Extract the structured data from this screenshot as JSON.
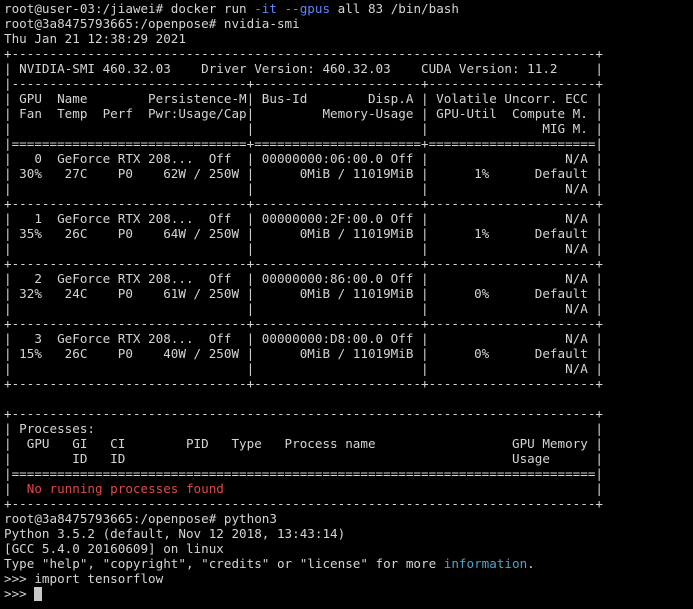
{
  "palette": {
    "background": "#000000",
    "text": "#d4d4d4",
    "option_flag": "#5f87ff",
    "error": "#e04848",
    "link": "#4fa3c7",
    "cursor": "#c8c8c8"
  },
  "terminal": {
    "lines": [
      [
        {
          "t": "root@user-03:/jiawei# docker run "
        },
        {
          "t": "-it",
          "c": "option_flag"
        },
        {
          "t": " "
        },
        {
          "t": "--gpus",
          "c": "option_flag"
        },
        {
          "t": " all 83 /bin/bash"
        }
      ],
      [
        {
          "t": "root@3a8475793665:/openpose# nvidia-smi"
        }
      ],
      [
        {
          "t": "Thu Jan 21 12:38:29 2021"
        }
      ],
      [
        {
          "t": "+-----------------------------------------------------------------------------+"
        }
      ],
      [
        {
          "t": "| NVIDIA-SMI 460.32.03    Driver Version: 460.32.03    CUDA Version: 11.2     |"
        }
      ],
      [
        {
          "t": "|-------------------------------+----------------------+----------------------+"
        }
      ],
      [
        {
          "t": "| GPU  Name        Persistence-M| Bus-Id        Disp.A | Volatile Uncorr. ECC |"
        }
      ],
      [
        {
          "t": "| Fan  Temp  Perf  Pwr:Usage/Cap|         Memory-Usage | GPU-Util  Compute M. |"
        }
      ],
      [
        {
          "t": "|                               |                      |               MIG M. |"
        }
      ],
      [
        {
          "t": "|===============================+======================+======================|"
        }
      ],
      [
        {
          "t": "|   0  GeForce RTX 208...  Off  | 00000000:06:00.0 Off |                  N/A |"
        }
      ],
      [
        {
          "t": "| 30%   27C    P0    62W / 250W |      0MiB / 11019MiB |      1%      Default |"
        }
      ],
      [
        {
          "t": "|                               |                      |                  N/A |"
        }
      ],
      [
        {
          "t": "+-------------------------------+----------------------+----------------------+"
        }
      ],
      [
        {
          "t": "|   1  GeForce RTX 208...  Off  | 00000000:2F:00.0 Off |                  N/A |"
        }
      ],
      [
        {
          "t": "| 35%   26C    P0    64W / 250W |      0MiB / 11019MiB |      1%      Default |"
        }
      ],
      [
        {
          "t": "|                               |                      |                  N/A |"
        }
      ],
      [
        {
          "t": "+-------------------------------+----------------------+----------------------+"
        }
      ],
      [
        {
          "t": "|   2  GeForce RTX 208...  Off  | 00000000:86:00.0 Off |                  N/A |"
        }
      ],
      [
        {
          "t": "| 32%   24C    P0    61W / 250W |      0MiB / 11019MiB |      0%      Default |"
        }
      ],
      [
        {
          "t": "|                               |                      |                  N/A |"
        }
      ],
      [
        {
          "t": "+-------------------------------+----------------------+----------------------+"
        }
      ],
      [
        {
          "t": "|   3  GeForce RTX 208...  Off  | 00000000:D8:00.0 Off |                  N/A |"
        }
      ],
      [
        {
          "t": "| 15%   26C    P0    40W / 250W |      0MiB / 11019MiB |      0%      Default |"
        }
      ],
      [
        {
          "t": "|                               |                      |                  N/A |"
        }
      ],
      [
        {
          "t": "+-------------------------------+----------------------+----------------------+"
        }
      ],
      [
        {
          "t": ""
        }
      ],
      [
        {
          "t": "+-----------------------------------------------------------------------------+"
        }
      ],
      [
        {
          "t": "| Processes:                                                                  |"
        }
      ],
      [
        {
          "t": "|  GPU   GI   CI        PID   Type   Process name                  GPU Memory |"
        }
      ],
      [
        {
          "t": "|        ID   ID                                                   Usage      |"
        }
      ],
      [
        {
          "t": "|=============================================================================|"
        }
      ],
      [
        {
          "t": "|  "
        },
        {
          "t": "No running processes found",
          "c": "error"
        },
        {
          "t": "                                                 |"
        }
      ],
      [
        {
          "t": "+-----------------------------------------------------------------------------+"
        }
      ],
      [
        {
          "t": "root@3a8475793665:/openpose# python3"
        }
      ],
      [
        {
          "t": "Python 3.5.2 (default, Nov 12 2018, 13:43:14)"
        }
      ],
      [
        {
          "t": "[GCC 5.4.0 20160609] on linux"
        }
      ],
      [
        {
          "t": "Type \"help\", \"copyright\", \"credits\" or \"license\" for more "
        },
        {
          "t": "information",
          "c": "link"
        },
        {
          "t": "."
        }
      ],
      [
        {
          "t": ">>> import tensorflow"
        }
      ],
      [
        {
          "t": ">>> "
        },
        {
          "cursor": true
        }
      ]
    ]
  }
}
